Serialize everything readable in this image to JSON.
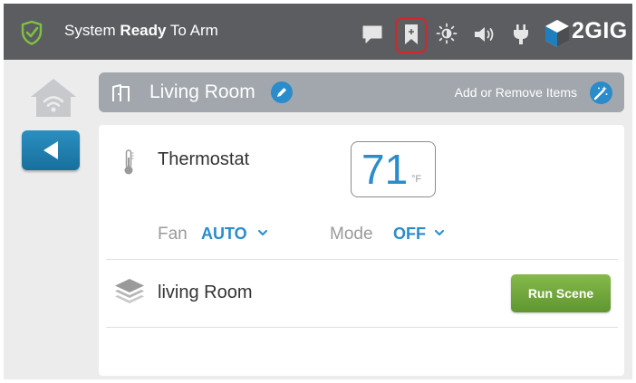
{
  "status_bar": {
    "status_prefix": "System",
    "status_bold": "Ready",
    "status_suffix": "To Arm",
    "brand": "2GIG",
    "icons": [
      "shield-check-icon",
      "chat-icon",
      "bookmark-icon",
      "brightness-icon",
      "volume-icon",
      "plug-icon",
      "2gig-logo-icon"
    ],
    "highlight_color": "#d9232a"
  },
  "left_rail": {
    "icons": [
      "home-wifi-icon",
      "back-arrow-icon"
    ]
  },
  "room_header": {
    "title": "Living Room",
    "add_remove_label": "Add or Remove Items",
    "icons": [
      "room-door-icon",
      "edit-pencil-icon",
      "magic-wand-icon"
    ]
  },
  "thermostat": {
    "label": "Thermostat",
    "temperature": "71",
    "unit": "°F",
    "fan_label": "Fan",
    "fan_value": "AUTO",
    "mode_label": "Mode",
    "mode_value": "OFF"
  },
  "scene": {
    "label": "living Room",
    "run_label": "Run Scene",
    "icon": "layers-icon"
  },
  "colors": {
    "accent_blue": "#2a8ccb",
    "run_green": "#6fa73b",
    "topbar": "#5b5d60",
    "header_gray": "#a2a7ad"
  }
}
